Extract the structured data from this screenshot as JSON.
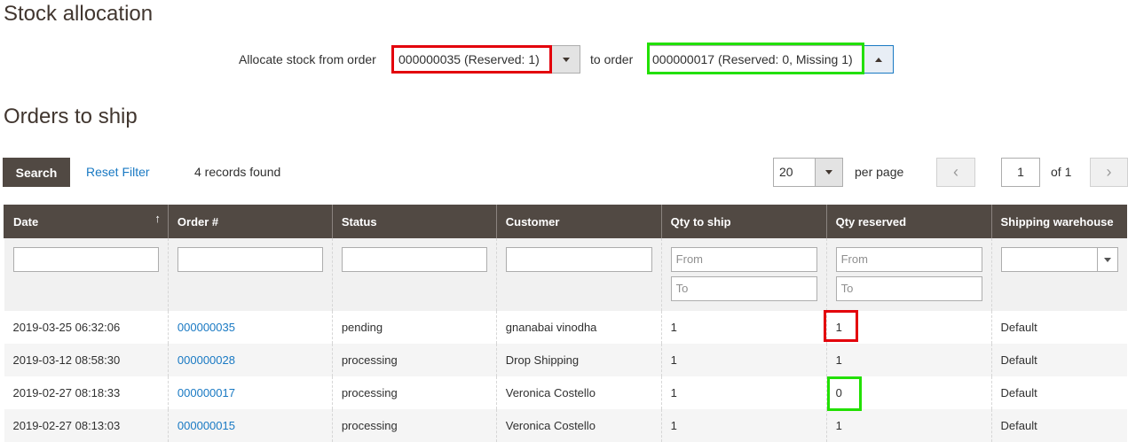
{
  "page_title": "Stock allocation",
  "allocation": {
    "from_label": "Allocate stock from order",
    "from_value": "000000035 (Reserved: 1)",
    "to_label": "to order",
    "to_value": "000000017 (Reserved: 0, Missing 1)"
  },
  "section_title": "Orders to ship",
  "toolbar": {
    "search_label": "Search",
    "reset_label": "Reset Filter",
    "records_text": "4 records found",
    "per_page_value": "20",
    "per_page_label": "per page",
    "page_value": "1",
    "page_of": "of 1"
  },
  "table": {
    "headers": [
      "Date",
      "Order #",
      "Status",
      "Customer",
      "Qty to ship",
      "Qty reserved",
      "Shipping warehouse"
    ],
    "filters": {
      "from_placeholder": "From",
      "to_placeholder": "To"
    },
    "rows": [
      {
        "date": "2019-03-25 06:32:06",
        "order": "000000035",
        "status": "pending",
        "customer": "gnanabai vinodha",
        "qty_ship": "1",
        "qty_reserved": "1",
        "warehouse": "Default"
      },
      {
        "date": "2019-03-12 08:58:30",
        "order": "000000028",
        "status": "processing",
        "customer": "Drop Shipping",
        "qty_ship": "1",
        "qty_reserved": "1",
        "warehouse": "Default"
      },
      {
        "date": "2019-02-27 08:18:33",
        "order": "000000017",
        "status": "processing",
        "customer": "Veronica Costello",
        "qty_ship": "1",
        "qty_reserved": "0",
        "warehouse": "Default"
      },
      {
        "date": "2019-02-27 08:13:03",
        "order": "000000015",
        "status": "processing",
        "customer": "Veronica Costello",
        "qty_ship": "1",
        "qty_reserved": "1",
        "warehouse": "Default"
      }
    ]
  },
  "colors": {
    "header_bg": "#514943",
    "link": "#1979c3",
    "highlight_red": "#e3000b",
    "highlight_green": "#22e000"
  }
}
